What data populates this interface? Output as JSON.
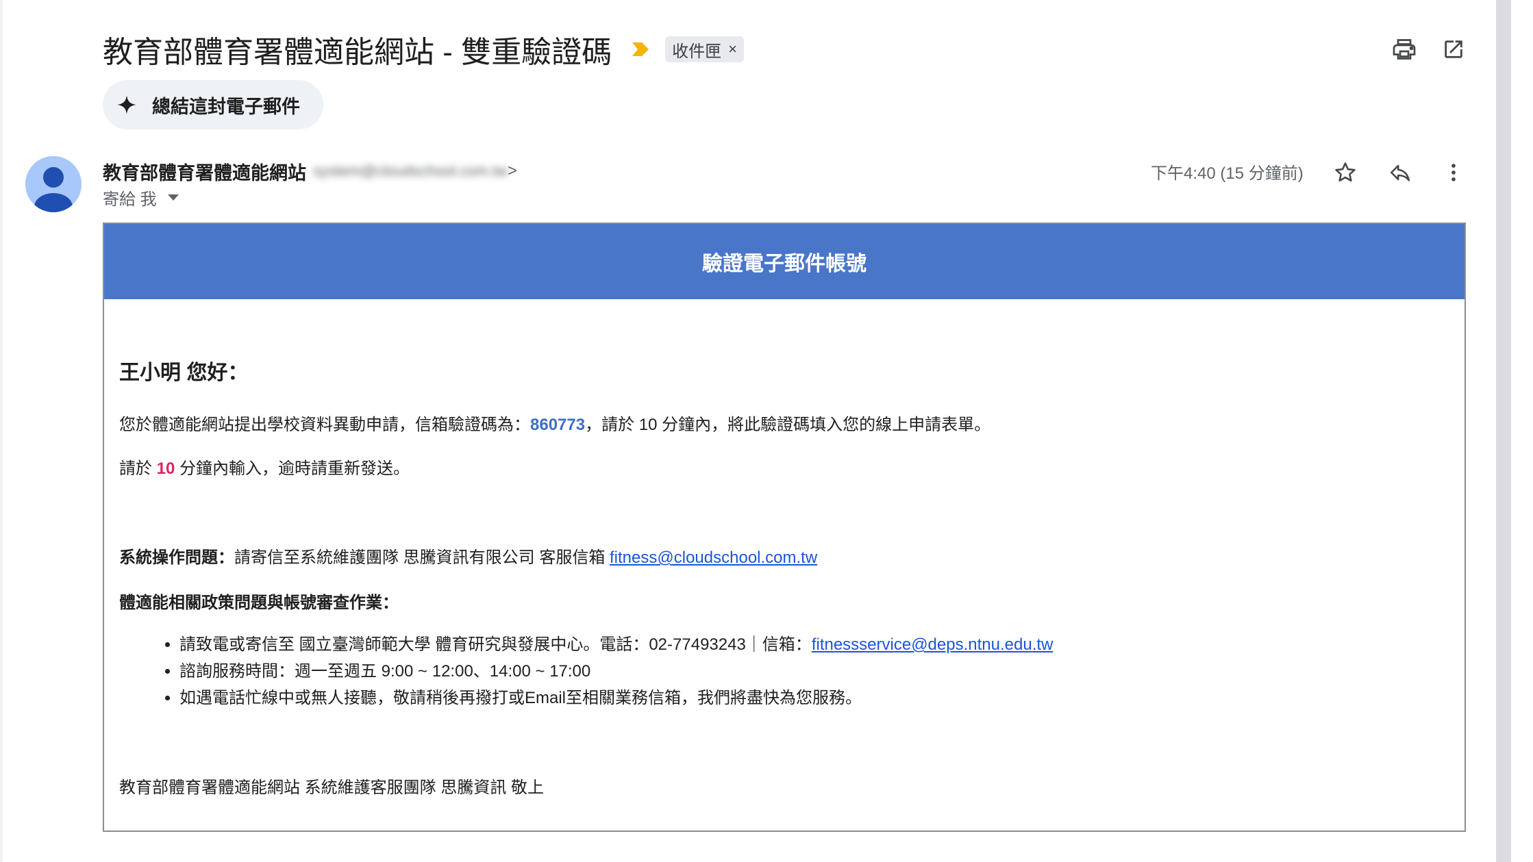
{
  "subject": {
    "title": "教育部體育署體適能網站 - 雙重驗證碼",
    "label": "收件匣",
    "label_remove": "×"
  },
  "summarize_button": "總結這封電子郵件",
  "sender": {
    "name": "教育部體育署體適能網站",
    "email_obscured": "system@cloudschool.com.tw",
    "email_suffix": ">",
    "to_label": "寄給 我",
    "time": "下午4:40 (15 分鐘前)"
  },
  "email": {
    "header": "驗證電子郵件帳號",
    "greeting": "王小明 您好：",
    "line1_prefix": "您於體適能網站提出學校資料異動申請，信箱驗證碼為：",
    "code": "860773",
    "line1_suffix": "，請於 10 分鐘內，將此驗證碼填入您的線上申請表單。",
    "line2_prefix": "請於 ",
    "line2_minutes": "10",
    "line2_suffix": " 分鐘內輸入，逾時請重新發送。",
    "support_label": "系統操作問題：",
    "support_text": "請寄信至系統維護團隊 思騰資訊有限公司 客服信箱 ",
    "support_email": "fitness@cloudschool.com.tw",
    "policy_label": "體適能相關政策問題與帳號審查作業：",
    "bullet1_text": "請致電或寄信至 國立臺灣師範大學 體育研究與發展中心。電話：02-77493243｜信箱：",
    "bullet1_email": "fitnessservice@deps.ntnu.edu.tw",
    "bullet2": "諮詢服務時間：週一至週五 9:00 ~ 12:00、14:00 ~ 17:00",
    "bullet3": "如遇電話忙線中或無人接聽，敬請稍後再撥打或Email至相關業務信箱，我們將盡快為您服務。",
    "signature": "教育部體育署體適能網站 系統維護客服團隊 思騰資訊 敬上"
  },
  "icons": [
    "importance-icon",
    "print-icon",
    "open-in-new-window-icon",
    "sparkle-icon",
    "avatar-icon",
    "star-icon",
    "reply-icon",
    "more-vert-icon",
    "dropdown-caret-icon"
  ],
  "colors": {
    "email_header": "#4a76c9",
    "code": "#3d6fc4",
    "minutes": "#e0245e",
    "link": "#1a55d8",
    "importance": "#f4b400"
  }
}
